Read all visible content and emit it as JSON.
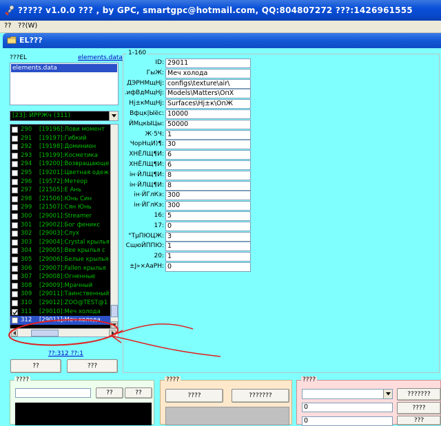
{
  "window": {
    "title": "????? v1.0.0 ??? , by GPC, smartgpc@hotmail.com, QQ:804807272 ???:1426961555"
  },
  "menu": {
    "items": [
      "??",
      "??(W)"
    ]
  },
  "child_window": {
    "title": "EL???"
  },
  "left_panel": {
    "label": "???EL",
    "link": "elements.data",
    "file_list": [
      "elements.data"
    ],
    "category_select": "[23]: ЙРРЖч (311)",
    "items": [
      {
        "num": "290",
        "name": "[19196]:Лови момент",
        "checked": false
      },
      {
        "num": "291",
        "name": "[19197]:Гибкий",
        "checked": false
      },
      {
        "num": "292",
        "name": "[19198]:Доминион",
        "checked": false
      },
      {
        "num": "293",
        "name": "[19199]:Косметика",
        "checked": false
      },
      {
        "num": "294",
        "name": "[19200]:Возвращающе",
        "checked": false
      },
      {
        "num": "295",
        "name": "[19201]:Цветная одеж",
        "checked": false
      },
      {
        "num": "296",
        "name": "[19572]:Метеор",
        "checked": false
      },
      {
        "num": "297",
        "name": "[21505]:Е Ань",
        "checked": false
      },
      {
        "num": "298",
        "name": "[21506]:Юнь Син",
        "checked": false
      },
      {
        "num": "299",
        "name": "[21507]:Сян Юнь",
        "checked": false
      },
      {
        "num": "300",
        "name": "[29001]:Streamer",
        "checked": false
      },
      {
        "num": "301",
        "name": "[29002]:Бог феникс",
        "checked": false
      },
      {
        "num": "302",
        "name": "[29003]:Слух",
        "checked": false
      },
      {
        "num": "303",
        "name": "[29004]:Crystal крылья",
        "checked": false
      },
      {
        "num": "304",
        "name": "[29005]:Вее крылья с",
        "checked": false
      },
      {
        "num": "305",
        "name": "[29006]:Белые крылья",
        "checked": false
      },
      {
        "num": "306",
        "name": "[29007]:Fallen крылья",
        "checked": false
      },
      {
        "num": "307",
        "name": "[29008]:Огненные",
        "checked": false
      },
      {
        "num": "308",
        "name": "[29009]:Мрачный",
        "checked": false
      },
      {
        "num": "309",
        "name": "[29011]:Таинственный",
        "checked": false
      },
      {
        "num": "310",
        "name": "[29012]:ZOO@TEST@1",
        "checked": false
      },
      {
        "num": "311",
        "name": "[29010]:Меч холода",
        "checked": true
      },
      {
        "num": "312",
        "name": "[29011]:Меч холода",
        "checked": false,
        "selected": true
      }
    ],
    "status": "??:312 ??:1",
    "btn1": "??",
    "btn2": "???"
  },
  "fields": {
    "group_label": "1-160",
    "rows": [
      {
        "label": "ID:",
        "value": "29011"
      },
      {
        "label": "ГыЖ:",
        "value": "Меч холода"
      },
      {
        "label": "ДЭРНМщНj:",
        "value": "configs\\texture\\air\\"
      },
      {
        "label": ".ифВдМщНj:",
        "value": "Models\\Matters\\ОпХ"
      },
      {
        "label": "Нj±кМщНj:",
        "value": "Surfaces\\Нj±к\\ОпЖ"
      },
      {
        "label": "Вфцк|Ыёс:",
        "value": "10000"
      },
      {
        "label": "ЙМцкЫЦы:",
        "value": "50000"
      },
      {
        "label": "Ж·5Ч:",
        "value": "1"
      },
      {
        "label": "ЧорНцИ)¶:",
        "value": "30"
      },
      {
        "label": "ХНЁЛЩ¶И:",
        "value": "6"
      },
      {
        "label": "ХНЁЛЩ¶И:",
        "value": "6"
      },
      {
        "label": "ін·ЙЛЩ¶И:",
        "value": "8"
      },
      {
        "label": "ін·ЙЛЩ¶И:",
        "value": "8"
      },
      {
        "label": "ін·ЙГлКэ:",
        "value": "300"
      },
      {
        "label": "ін·ЙГлКэ:",
        "value": "300"
      },
      {
        "label": "16:",
        "value": "5"
      },
      {
        "label": "17:",
        "value": "0"
      },
      {
        "label": "°ТµПЮЦЖ:",
        "value": "3"
      },
      {
        "label": "СщюЙППЮ:",
        "value": "1"
      },
      {
        "label": "20:",
        "value": "1"
      },
      {
        "label": "±J»×АаРН:",
        "value": "0"
      }
    ]
  },
  "bottom": {
    "group1": {
      "label": "????",
      "btn1": "??",
      "btn2": "??"
    },
    "group2": {
      "label": "????",
      "btn1": "????",
      "btn2": "???????"
    },
    "group3": {
      "label": "????",
      "btn1": "???????",
      "btn2": "????",
      "btn3": "???",
      "val1": "0",
      "val2": "0"
    }
  },
  "colors": {
    "background": "#80ffff",
    "list_bg": "#000000",
    "list_text": "#00c000",
    "selection": "#2b50c8",
    "annotation": "#e02020"
  }
}
